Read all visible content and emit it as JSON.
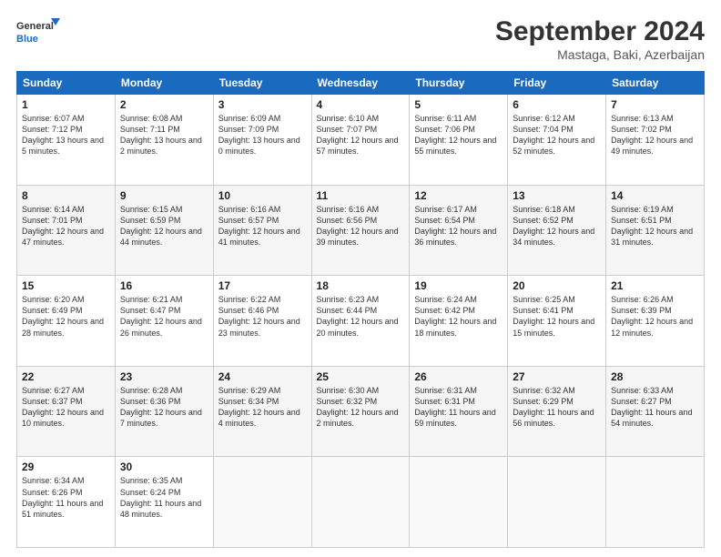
{
  "header": {
    "logo_line1": "General",
    "logo_line2": "Blue",
    "title": "September 2024",
    "subtitle": "Mastaga, Baki, Azerbaijan"
  },
  "calendar": {
    "headers": [
      "Sunday",
      "Monday",
      "Tuesday",
      "Wednesday",
      "Thursday",
      "Friday",
      "Saturday"
    ],
    "rows": [
      [
        {
          "day": "1",
          "rise": "Sunrise: 6:07 AM",
          "set": "Sunset: 7:12 PM",
          "daylight": "Daylight: 13 hours and 5 minutes."
        },
        {
          "day": "2",
          "rise": "Sunrise: 6:08 AM",
          "set": "Sunset: 7:11 PM",
          "daylight": "Daylight: 13 hours and 2 minutes."
        },
        {
          "day": "3",
          "rise": "Sunrise: 6:09 AM",
          "set": "Sunset: 7:09 PM",
          "daylight": "Daylight: 13 hours and 0 minutes."
        },
        {
          "day": "4",
          "rise": "Sunrise: 6:10 AM",
          "set": "Sunset: 7:07 PM",
          "daylight": "Daylight: 12 hours and 57 minutes."
        },
        {
          "day": "5",
          "rise": "Sunrise: 6:11 AM",
          "set": "Sunset: 7:06 PM",
          "daylight": "Daylight: 12 hours and 55 minutes."
        },
        {
          "day": "6",
          "rise": "Sunrise: 6:12 AM",
          "set": "Sunset: 7:04 PM",
          "daylight": "Daylight: 12 hours and 52 minutes."
        },
        {
          "day": "7",
          "rise": "Sunrise: 6:13 AM",
          "set": "Sunset: 7:02 PM",
          "daylight": "Daylight: 12 hours and 49 minutes."
        }
      ],
      [
        {
          "day": "8",
          "rise": "Sunrise: 6:14 AM",
          "set": "Sunset: 7:01 PM",
          "daylight": "Daylight: 12 hours and 47 minutes."
        },
        {
          "day": "9",
          "rise": "Sunrise: 6:15 AM",
          "set": "Sunset: 6:59 PM",
          "daylight": "Daylight: 12 hours and 44 minutes."
        },
        {
          "day": "10",
          "rise": "Sunrise: 6:16 AM",
          "set": "Sunset: 6:57 PM",
          "daylight": "Daylight: 12 hours and 41 minutes."
        },
        {
          "day": "11",
          "rise": "Sunrise: 6:16 AM",
          "set": "Sunset: 6:56 PM",
          "daylight": "Daylight: 12 hours and 39 minutes."
        },
        {
          "day": "12",
          "rise": "Sunrise: 6:17 AM",
          "set": "Sunset: 6:54 PM",
          "daylight": "Daylight: 12 hours and 36 minutes."
        },
        {
          "day": "13",
          "rise": "Sunrise: 6:18 AM",
          "set": "Sunset: 6:52 PM",
          "daylight": "Daylight: 12 hours and 34 minutes."
        },
        {
          "day": "14",
          "rise": "Sunrise: 6:19 AM",
          "set": "Sunset: 6:51 PM",
          "daylight": "Daylight: 12 hours and 31 minutes."
        }
      ],
      [
        {
          "day": "15",
          "rise": "Sunrise: 6:20 AM",
          "set": "Sunset: 6:49 PM",
          "daylight": "Daylight: 12 hours and 28 minutes."
        },
        {
          "day": "16",
          "rise": "Sunrise: 6:21 AM",
          "set": "Sunset: 6:47 PM",
          "daylight": "Daylight: 12 hours and 26 minutes."
        },
        {
          "day": "17",
          "rise": "Sunrise: 6:22 AM",
          "set": "Sunset: 6:46 PM",
          "daylight": "Daylight: 12 hours and 23 minutes."
        },
        {
          "day": "18",
          "rise": "Sunrise: 6:23 AM",
          "set": "Sunset: 6:44 PM",
          "daylight": "Daylight: 12 hours and 20 minutes."
        },
        {
          "day": "19",
          "rise": "Sunrise: 6:24 AM",
          "set": "Sunset: 6:42 PM",
          "daylight": "Daylight: 12 hours and 18 minutes."
        },
        {
          "day": "20",
          "rise": "Sunrise: 6:25 AM",
          "set": "Sunset: 6:41 PM",
          "daylight": "Daylight: 12 hours and 15 minutes."
        },
        {
          "day": "21",
          "rise": "Sunrise: 6:26 AM",
          "set": "Sunset: 6:39 PM",
          "daylight": "Daylight: 12 hours and 12 minutes."
        }
      ],
      [
        {
          "day": "22",
          "rise": "Sunrise: 6:27 AM",
          "set": "Sunset: 6:37 PM",
          "daylight": "Daylight: 12 hours and 10 minutes."
        },
        {
          "day": "23",
          "rise": "Sunrise: 6:28 AM",
          "set": "Sunset: 6:36 PM",
          "daylight": "Daylight: 12 hours and 7 minutes."
        },
        {
          "day": "24",
          "rise": "Sunrise: 6:29 AM",
          "set": "Sunset: 6:34 PM",
          "daylight": "Daylight: 12 hours and 4 minutes."
        },
        {
          "day": "25",
          "rise": "Sunrise: 6:30 AM",
          "set": "Sunset: 6:32 PM",
          "daylight": "Daylight: 12 hours and 2 minutes."
        },
        {
          "day": "26",
          "rise": "Sunrise: 6:31 AM",
          "set": "Sunset: 6:31 PM",
          "daylight": "Daylight: 11 hours and 59 minutes."
        },
        {
          "day": "27",
          "rise": "Sunrise: 6:32 AM",
          "set": "Sunset: 6:29 PM",
          "daylight": "Daylight: 11 hours and 56 minutes."
        },
        {
          "day": "28",
          "rise": "Sunrise: 6:33 AM",
          "set": "Sunset: 6:27 PM",
          "daylight": "Daylight: 11 hours and 54 minutes."
        }
      ],
      [
        {
          "day": "29",
          "rise": "Sunrise: 6:34 AM",
          "set": "Sunset: 6:26 PM",
          "daylight": "Daylight: 11 hours and 51 minutes."
        },
        {
          "day": "30",
          "rise": "Sunrise: 6:35 AM",
          "set": "Sunset: 6:24 PM",
          "daylight": "Daylight: 11 hours and 48 minutes."
        },
        {
          "day": "",
          "rise": "",
          "set": "",
          "daylight": ""
        },
        {
          "day": "",
          "rise": "",
          "set": "",
          "daylight": ""
        },
        {
          "day": "",
          "rise": "",
          "set": "",
          "daylight": ""
        },
        {
          "day": "",
          "rise": "",
          "set": "",
          "daylight": ""
        },
        {
          "day": "",
          "rise": "",
          "set": "",
          "daylight": ""
        }
      ]
    ]
  }
}
